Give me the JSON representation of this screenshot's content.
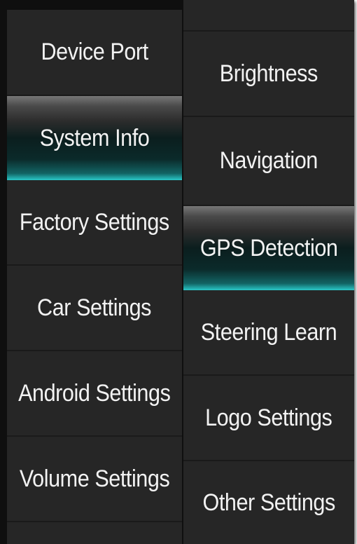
{
  "left_menu": {
    "items": [
      {
        "label": "Device Port",
        "selected": false
      },
      {
        "label": "System Info",
        "selected": true
      },
      {
        "label": "Factory Settings",
        "selected": false
      },
      {
        "label": "Car Settings",
        "selected": false
      },
      {
        "label": "Android Settings",
        "selected": false
      },
      {
        "label": "Volume Settings",
        "selected": false
      }
    ]
  },
  "right_menu": {
    "items": [
      {
        "label": "Brightness",
        "selected": false
      },
      {
        "label": "Navigation",
        "selected": false
      },
      {
        "label": "GPS Detection",
        "selected": true
      },
      {
        "label": "Steering Learn",
        "selected": false
      },
      {
        "label": "Logo Settings",
        "selected": false
      },
      {
        "label": "Other Settings",
        "selected": false
      }
    ]
  },
  "colors": {
    "panel_background": "#262626",
    "divider": "#1a1a1a",
    "selected_accent": "#2ac9c9",
    "text": "#f2f2f2"
  }
}
